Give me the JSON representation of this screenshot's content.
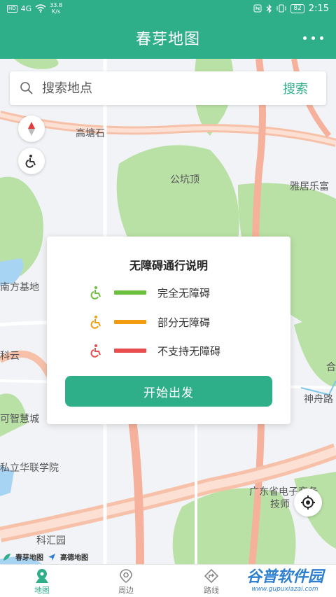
{
  "status_bar": {
    "hd": "HD",
    "network": "4G",
    "speed_value": "33.8",
    "speed_unit": "K/s",
    "battery": "82",
    "time": "2:15"
  },
  "header": {
    "title": "春芽地图"
  },
  "search": {
    "placeholder": "搜索地点",
    "button_label": "搜索"
  },
  "map": {
    "labels": [
      "高塘石",
      "公坑顶",
      "雅居乐富",
      "南方基地",
      "科云",
      "神舟路",
      "可智慧城",
      "私立华联学院",
      "广东省电子商务",
      "技师",
      "科汇园",
      "合"
    ]
  },
  "dialog": {
    "title": "无障碍通行说明",
    "legend": [
      {
        "label": "完全无障碍",
        "color": "#6dbf3f"
      },
      {
        "label": "部分无障碍",
        "color": "#f39c12"
      },
      {
        "label": "不支持无障碍",
        "color": "#e84c4c"
      }
    ],
    "start_label": "开始出发"
  },
  "attribution": {
    "app": "春芽地图",
    "provider": "高德地图"
  },
  "tabs": [
    {
      "label": "地图",
      "icon": "map-pin-icon",
      "active": true
    },
    {
      "label": "周边",
      "icon": "nearby-icon",
      "active": false
    },
    {
      "label": "路线",
      "icon": "route-icon",
      "active": false
    }
  ],
  "watermark": {
    "text": "谷普软件园",
    "url": "www.gupuxiazai.com"
  },
  "colors": {
    "primary": "#2fae8a"
  }
}
